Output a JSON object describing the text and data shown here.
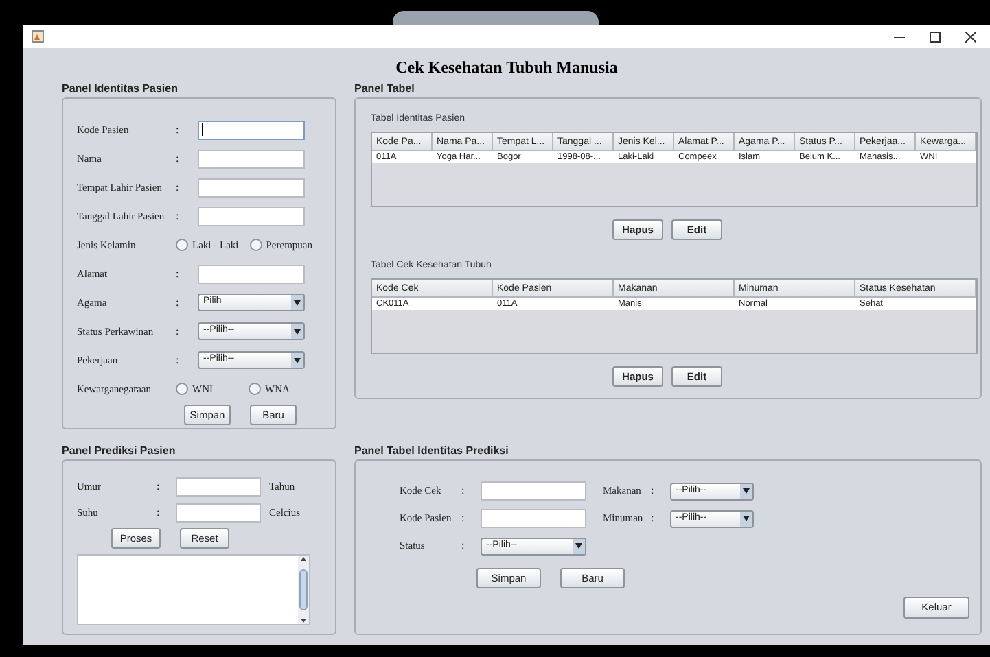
{
  "heading": "Cek Kesehatan Tubuh Manusia",
  "identity_panel": {
    "title": "Panel Identitas Pasien",
    "rows": [
      {
        "kind": "text",
        "label": "Kode Pasien",
        "separator": ":",
        "focused": true
      },
      {
        "kind": "text",
        "label": "Nama",
        "separator": ":",
        "focused": false
      },
      {
        "kind": "text",
        "label": "Tempat Lahir Pasien",
        "separator": ":",
        "focused": false
      },
      {
        "kind": "text",
        "label": "Tanggal Lahir Pasien",
        "separator": ":",
        "focused": false
      },
      {
        "kind": "radio",
        "label": "Jenis Kelamin",
        "options": [
          {
            "label": "Laki - Laki",
            "selected": false
          },
          {
            "label": "Perempuan",
            "selected": false
          }
        ]
      },
      {
        "kind": "text",
        "label": "Alamat",
        "separator": ":",
        "focused": false
      },
      {
        "kind": "combo",
        "label": "Agama",
        "separator": ":",
        "value": "Pilih"
      },
      {
        "kind": "combo",
        "label": "Status Perkawinan",
        "separator": ":",
        "value": "--Pilih--"
      },
      {
        "kind": "combo",
        "label": "Pekerjaan",
        "separator": ":",
        "value": "--Pilih--"
      },
      {
        "kind": "radio",
        "label": "Kewarganegaraan",
        "options": [
          {
            "label": "WNI",
            "selected": false
          },
          {
            "label": "WNA",
            "selected": false
          }
        ]
      }
    ],
    "buttons": [
      "Simpan",
      "Baru"
    ]
  },
  "table_panel": {
    "title": "Panel Tabel",
    "tables": [
      {
        "title": "Tabel Identitas Pasien",
        "columns": [
          "Kode Pa...",
          "Nama Pa...",
          "Tempat L...",
          "Tanggal ...",
          "Jenis Kel...",
          "Alamat P...",
          "Agama P...",
          "Status P...",
          "Pekerjaa...",
          "Kewarga..."
        ],
        "rows": [
          [
            "011A",
            "Yoga Har...",
            "Bogor",
            "1998-08-...",
            "Laki-Laki",
            "Compeex",
            "Islam",
            "Belum K...",
            "Mahasis...",
            "WNI"
          ]
        ],
        "buttons": [
          "Hapus",
          "Edit"
        ]
      },
      {
        "title": "Tabel Cek Kesehatan Tubuh",
        "columns": [
          "Kode Cek",
          "Kode Pasien",
          "Makanan",
          "Minuman",
          "Status Kesehatan"
        ],
        "rows": [
          [
            "CK011A",
            "011A",
            "Manis",
            "Normal",
            "Sehat"
          ]
        ],
        "buttons": [
          "Hapus",
          "Edit"
        ]
      }
    ]
  },
  "prediction_panel": {
    "title": "Panel Prediksi Pasien",
    "rows": [
      {
        "label": "Umur",
        "separator": ":",
        "unit": "Tahun"
      },
      {
        "label": "Suhu",
        "separator": ":",
        "unit": "Celcius"
      }
    ],
    "buttons": [
      "Proses",
      "Reset"
    ]
  },
  "prediction_table_panel": {
    "title": "Panel Tabel Identitas Prediksi",
    "left_rows": [
      {
        "kind": "text",
        "label": "Kode Cek",
        "separator": ":"
      },
      {
        "kind": "text",
        "label": "Kode Pasien",
        "separator": ":"
      },
      {
        "kind": "combo",
        "label": "Status",
        "separator": ":",
        "value": "--Pilih--"
      }
    ],
    "right_rows": [
      {
        "kind": "combo",
        "label": "Makanan",
        "separator": ":",
        "value": "--Pilih--"
      },
      {
        "kind": "combo",
        "label": "Minuman",
        "separator": ":",
        "value": "--Pilih--"
      }
    ],
    "buttons": [
      "Simpan",
      "Baru"
    ],
    "exit_button": "Keluar"
  }
}
